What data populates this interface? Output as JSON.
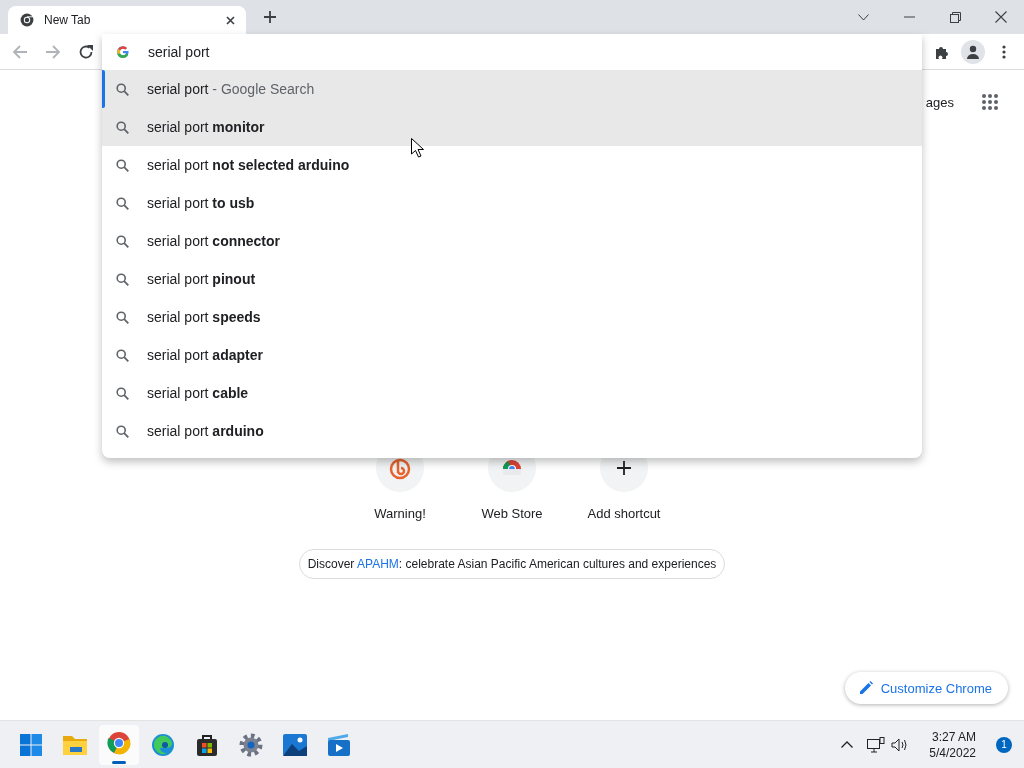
{
  "tabs": [
    {
      "title": "New Tab",
      "selected": true
    }
  ],
  "omnibox": {
    "value": "serial port"
  },
  "suggestions": [
    {
      "text": "serial port",
      "suffix": "- Google Search",
      "selected": true,
      "hovered": false
    },
    {
      "text": "serial port **monitor**",
      "selected": false,
      "hovered": true
    },
    {
      "text": "serial port **not selected arduino**",
      "selected": false,
      "hovered": false
    },
    {
      "text": "serial port **to usb**",
      "selected": false,
      "hovered": false
    },
    {
      "text": "serial port **connector**",
      "selected": false,
      "hovered": false
    },
    {
      "text": "serial port **pinout**",
      "selected": false,
      "hovered": false
    },
    {
      "text": "serial port **speeds**",
      "selected": false,
      "hovered": false
    },
    {
      "text": "serial port **adapter**",
      "selected": false,
      "hovered": false
    },
    {
      "text": "serial port **cable**",
      "selected": false,
      "hovered": false
    },
    {
      "text": "serial port **arduino**",
      "selected": false,
      "hovered": false
    }
  ],
  "header": {
    "images_link": "ages"
  },
  "shortcuts": [
    {
      "label": "Warning!",
      "kind": "warning"
    },
    {
      "label": "Web Store",
      "kind": "webstore"
    },
    {
      "label": "Add shortcut",
      "kind": "add"
    }
  ],
  "promo": {
    "prefix": "Discover",
    "link": "APAHM",
    "rest": ": celebrate Asian Pacific American cultures and experiences"
  },
  "customize_button": "Customize Chrome",
  "taskbar": {
    "apps": [
      {
        "kind": "start",
        "active": false
      },
      {
        "kind": "explorer",
        "active": false
      },
      {
        "kind": "chrome",
        "active": true
      },
      {
        "kind": "edge",
        "active": false
      },
      {
        "kind": "store",
        "active": false
      },
      {
        "kind": "settings",
        "active": false
      },
      {
        "kind": "photos",
        "active": false
      },
      {
        "kind": "media",
        "active": false
      }
    ],
    "time": "3:27 AM",
    "date": "5/4/2022",
    "notifications": "1"
  }
}
